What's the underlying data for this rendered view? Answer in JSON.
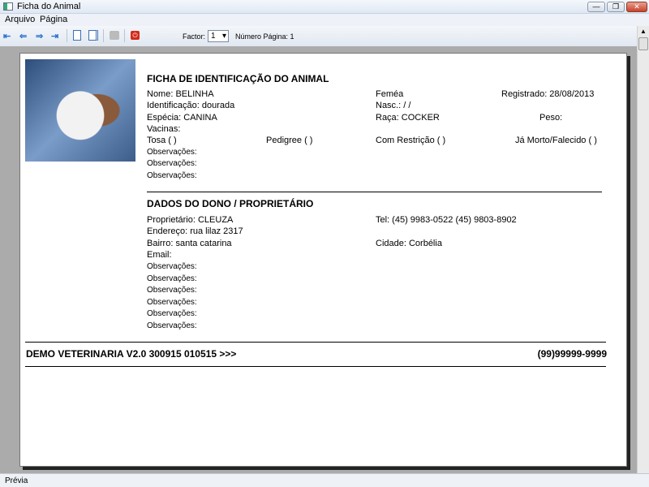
{
  "window": {
    "title": "Ficha do Animal",
    "min": "—",
    "max": "❐",
    "close": "✕"
  },
  "menu": [
    "Arquivo",
    "Página"
  ],
  "toolbar": {
    "factor_label": "Factor:",
    "factor_value": "1",
    "page_label": "Número Página: 1"
  },
  "report": {
    "title": "FICHA DE IDENTIFICAÇÃO DO ANIMAL",
    "nome": "Nome: BELINHA",
    "sexo": "Feméa",
    "registrado": "Registrado: 28/08/2013",
    "identificacao": "Identificação: dourada",
    "nasc": "Nasc.:  / /",
    "especie": "Espécia: CANINA",
    "raca": "Raça: COCKER",
    "peso": "Peso:",
    "vacinas": "Vacinas:",
    "tosa": "Tosa  ( )",
    "pedigree": "Pedigree  ( )",
    "restricao": "Com Restrição ( )",
    "morto": "Já Morto/Falecido ( )",
    "obs": "Observações:",
    "owner_title": "DADOS DO DONO / PROPRIETÁRIO",
    "proprietario": "Proprietário: CLEUZA",
    "tel": "Tel: (45) 9983-0522  (45) 9803-8902",
    "endereco": "Endereço: rua lilaz 2317",
    "bairro": "Bairro: santa catarina",
    "cidade": "Cidade: Corbélia",
    "email": "Email:",
    "footer_left": "DEMO VETERINARIA V2.0 300915 010515 >>>",
    "footer_right": "(99)99999-9999"
  },
  "status": "Prévia"
}
